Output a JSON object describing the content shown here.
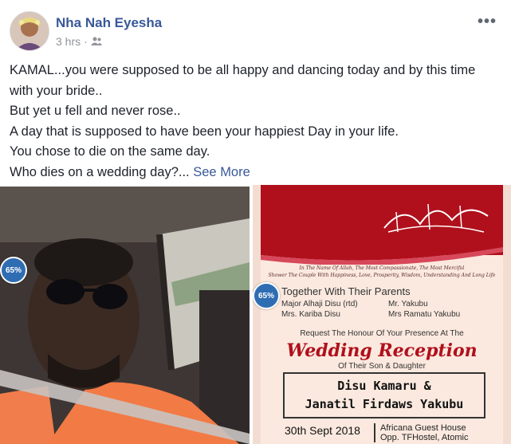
{
  "post": {
    "author": "Nha Nah Eyesha",
    "time": "3 hrs",
    "separator": "·",
    "audience_icon": "friends-icon",
    "more_icon": "more-options-icon",
    "more_glyph": "•••"
  },
  "body": {
    "lines": [
      "KAMAL...you were supposed to be all happy and dancing today and by this time with your bride..",
      "But yet u fell and never rose..",
      "A day that is supposed to have been your happiest Day in your life.",
      "You chose to die on the same day.",
      "Who dies on a wedding day?..."
    ],
    "see_more": "See More"
  },
  "photos": {
    "left_badge": "65%",
    "right_badge": "65%"
  },
  "invitation": {
    "small_lines": [
      "In The Name Of Allah, The Most Compassionate, The Most Merciful",
      "Shower The Couple With Happiness, Love, Prosperity, Wisdom, Understanding And Long Life"
    ],
    "together": "Together With Their Parents",
    "parent_1a": "Major Alhaji  Disu (rtd)",
    "parent_1b": "Mrs. Kariba Disu",
    "parent_2a": "Mr. Yakubu",
    "parent_2b": "Mrs Ramatu Yakubu",
    "request": "Request The Honour Of Your Presence At The",
    "wedding": "Wedding Reception",
    "of_their": "Of Their Son & Daughter",
    "couple_1": "Disu Kamaru  &",
    "couple_2": "Janatil Firdaws Yakubu",
    "date": "30th Sept 2018",
    "venue_1": "Africana Guest House",
    "venue_2": "Opp. TFHostel, Atomic"
  },
  "colors": {
    "link": "#385898",
    "invitation_red": "#b0101c",
    "badge": "#2f6db3"
  }
}
